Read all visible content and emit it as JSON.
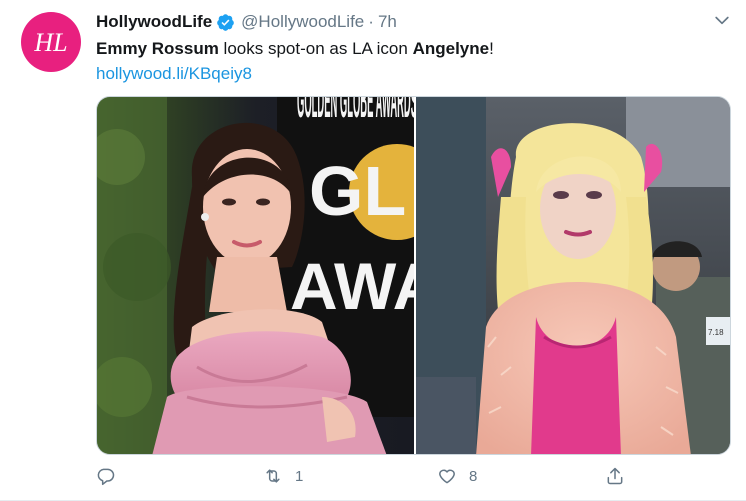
{
  "tweet": {
    "display_name": "HollywoodLife",
    "handle": "@HollywoodLife",
    "separator": "·",
    "timestamp": "7h",
    "avatar_text": "HL",
    "text_name": "Emmy Rossum",
    "text_middle": " looks spot-on as LA icon ",
    "text_subject": "Angelyne",
    "text_end": "!",
    "link": "hollywood.li/KBqeiy8",
    "media_text_left": "GOLDEN GLOBE AWARDS",
    "media_text_right": "7.18",
    "reply_count": "",
    "retweet_count": "1",
    "like_count": "8"
  },
  "colors": {
    "accent": "#1b95e0",
    "brand": "#e8207f",
    "muted": "#657786"
  },
  "icons": [
    "verified-icon",
    "chevron-down-icon",
    "reply-icon",
    "retweet-icon",
    "like-icon",
    "share-icon"
  ]
}
